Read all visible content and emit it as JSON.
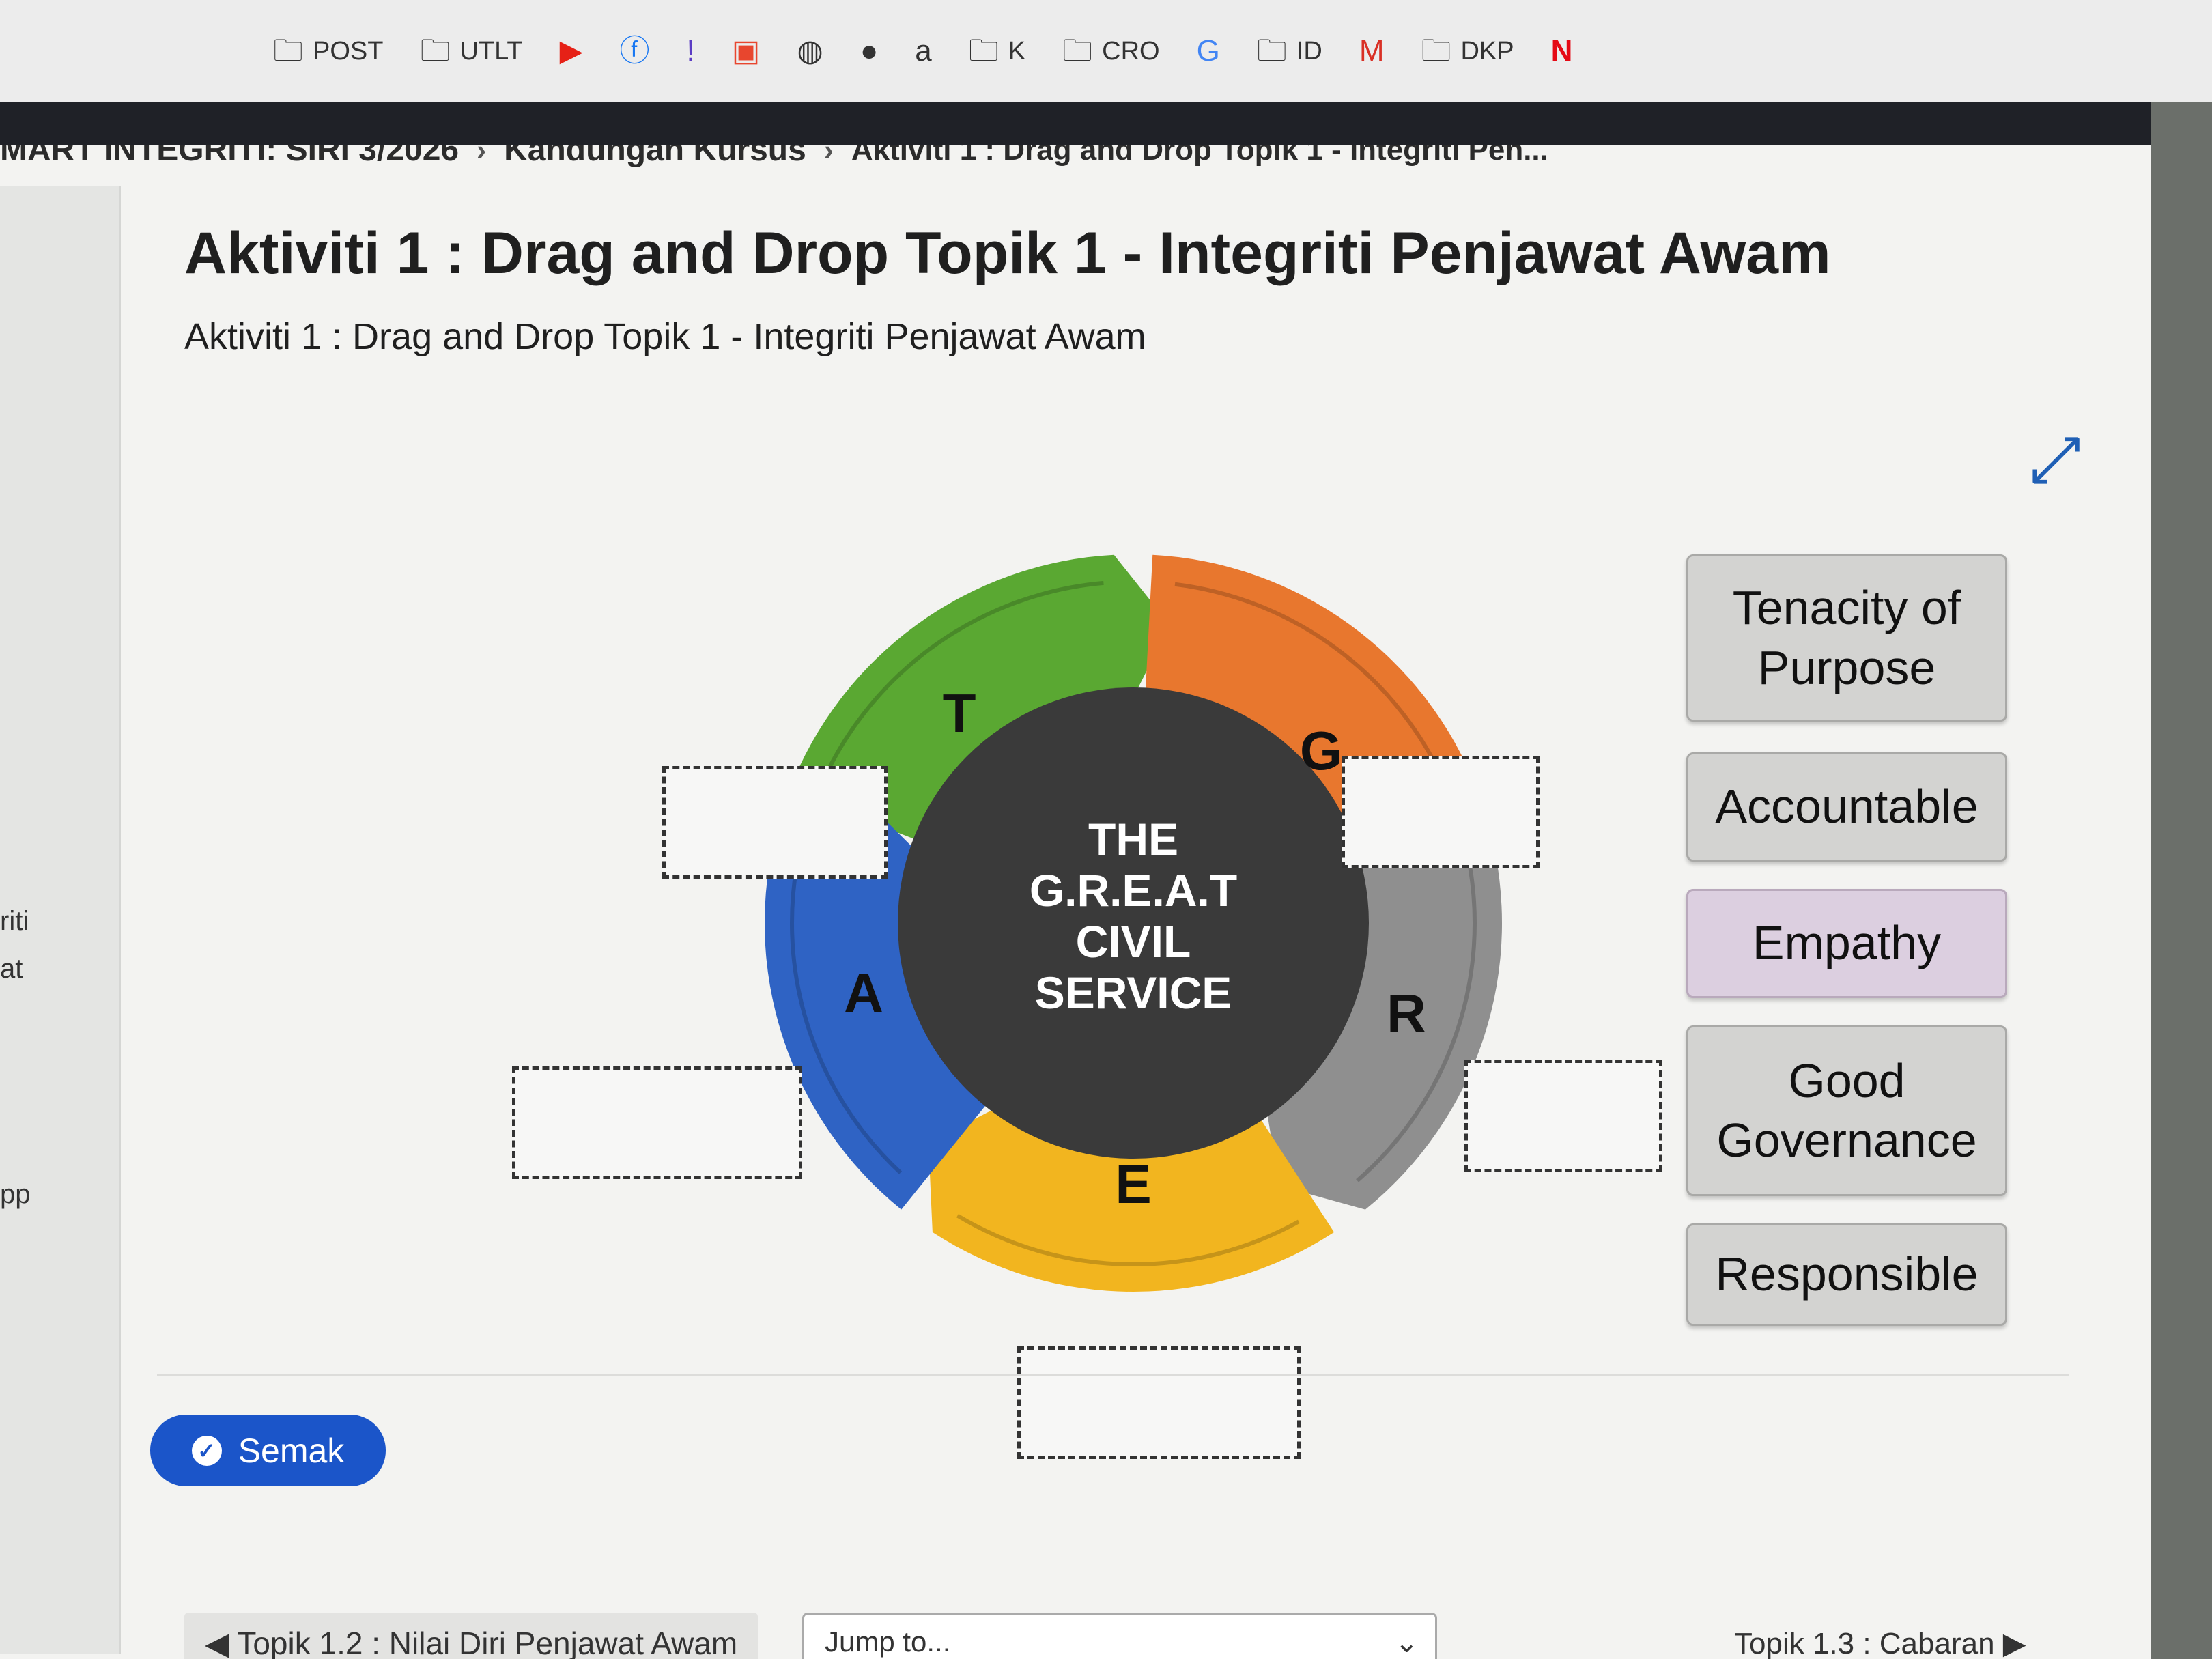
{
  "browser": {
    "bookmarks": [
      {
        "icon": "folder-icon",
        "label": "POST"
      },
      {
        "icon": "folder-icon",
        "label": "UTLT"
      },
      {
        "icon": "youtube-icon",
        "label": ""
      },
      {
        "icon": "facebook-icon",
        "label": ""
      },
      {
        "icon": "exclaim-icon",
        "label": ""
      },
      {
        "icon": "shopee-icon",
        "label": ""
      },
      {
        "icon": "globe-icon",
        "label": ""
      },
      {
        "icon": "badge-icon",
        "label": ""
      },
      {
        "icon": "amazon-icon",
        "label": ""
      },
      {
        "icon": "folder-icon",
        "label": "K"
      },
      {
        "icon": "folder-icon",
        "label": "CRO"
      },
      {
        "icon": "google-icon",
        "label": ""
      },
      {
        "icon": "folder-icon",
        "label": "ID"
      },
      {
        "icon": "gmail-icon",
        "label": ""
      },
      {
        "icon": "folder-icon",
        "label": "DKP"
      },
      {
        "icon": "netflix-icon",
        "label": ""
      }
    ]
  },
  "breadcrumb": {
    "items": [
      "MART INTEGRITI: SIRI 3/2026",
      "Kandungan Kursus",
      "Aktiviti 1 : Drag and Drop Topik 1 - Integriti Pen..."
    ]
  },
  "sidebar_fragments": [
    "riti",
    "at",
    "pp"
  ],
  "page": {
    "title": "Aktiviti 1 : Drag and Drop Topik 1 - Integriti Penjawat Awam",
    "subtitle": "Aktiviti 1 : Drag and Drop Topik 1 - Integriti Penjawat Awam"
  },
  "diagram": {
    "center_lines": [
      "THE",
      "G.R.E.A.T",
      "CIVIL",
      "SERVICE"
    ],
    "segments": [
      {
        "letter": "T",
        "color": "#5aa832"
      },
      {
        "letter": "G",
        "color": "#e8772e"
      },
      {
        "letter": "R",
        "color": "#8f8f8f"
      },
      {
        "letter": "E",
        "color": "#f2b51f"
      },
      {
        "letter": "A",
        "color": "#2f63c4"
      }
    ],
    "center_color": "#3a3a3a"
  },
  "choices": [
    "Tenacity of Purpose",
    "Accountable",
    "Empathy",
    "Good Governance",
    "Responsible"
  ],
  "buttons": {
    "check": "Semak"
  },
  "footer": {
    "prev": "Topik 1.2 : Nilai Diri Penjawat Awam",
    "jump_placeholder": "Jump to...",
    "next": "Topik 1.3 : Cabaran"
  }
}
